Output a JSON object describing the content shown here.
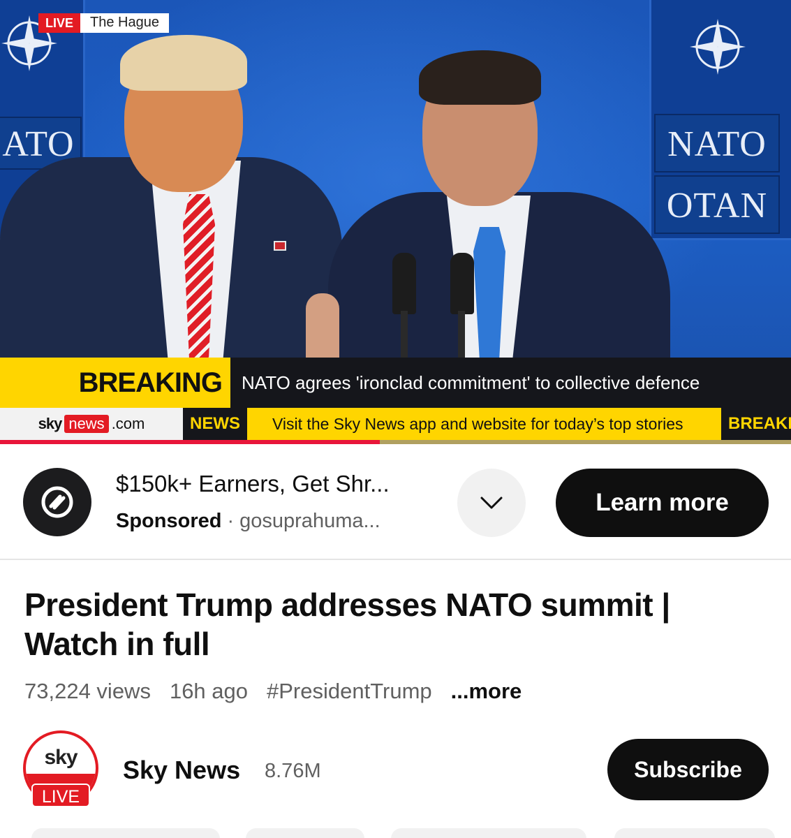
{
  "video": {
    "live_badge": "LIVE",
    "location": "The Hague",
    "nato_left_word": "ATO",
    "nato_right_word_top": "NATO",
    "nato_right_word_bottom": "OTAN",
    "breaking_label": "BREAKING NEWS",
    "breaking_text": "NATO agrees 'ironclad commitment' to collective defence",
    "site_sky": "sky",
    "site_news": "news",
    "site_com": ".com",
    "ticker_tag": "NEWS",
    "ticker_text": "Visit the Sky News app and website for today’s top stories",
    "ticker_tag_right": "BREAKING",
    "progress_fraction": 0.48
  },
  "ad": {
    "title": "$150k+ Earners, Get Shr...",
    "sponsored": "Sponsored",
    "separator": "·",
    "domain": "gosuprahuma...",
    "cta": "Learn more"
  },
  "title": "President Trump addresses NATO summit | Watch in full",
  "meta": {
    "views": "73,224 views",
    "age": "16h ago",
    "hashtag": "#PresidentTrump",
    "more": "...more"
  },
  "channel": {
    "avatar_sky": "sky",
    "live_badge": "LIVE",
    "name": "Sky News",
    "subscribers": "8.76M",
    "subscribe_label": "Subscribe"
  },
  "colors": {
    "sky_red": "#e31b23",
    "breaking_yellow": "#ffd500",
    "dark": "#0f0f0f"
  }
}
